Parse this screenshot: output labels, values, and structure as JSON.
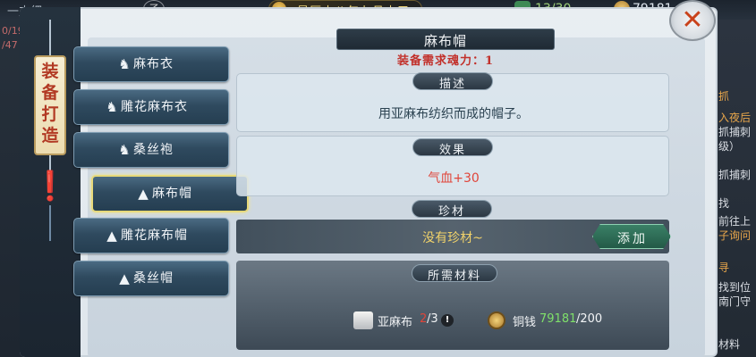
{
  "top_bar": {
    "left_text": "一支细",
    "zi_icon": "子",
    "date": "炅历十八年九月十五",
    "counter": "13/30",
    "coins": "79181"
  },
  "left_strip": {
    "num1": "0/19",
    "num2": "/47"
  },
  "side_tab": {
    "title": "装备打造"
  },
  "items": [
    {
      "icon": "clothes-icon",
      "label": "麻布衣",
      "selected": false
    },
    {
      "icon": "clothes-icon",
      "label": "雕花麻布衣",
      "selected": false
    },
    {
      "icon": "robe-icon",
      "label": "桑丝袍",
      "selected": false
    },
    {
      "icon": "hat-icon",
      "label": "麻布帽",
      "selected": true
    },
    {
      "icon": "hat-icon",
      "label": "雕花麻布帽",
      "selected": false
    },
    {
      "icon": "hat-icon",
      "label": "桑丝帽",
      "selected": false
    }
  ],
  "detail": {
    "title": "麻布帽",
    "requirement": "装备需求魂力：1",
    "description_header": "描述",
    "description": "用亚麻布纺织而成的帽子。",
    "effect_header": "效果",
    "effect": "气血+30",
    "gem_header": "珍材",
    "gem_status": "没有珍材~",
    "add_button": "添加",
    "materials_header": "所需材料",
    "materials": [
      {
        "icon": "linen-cloth-icon",
        "name": "亚麻布",
        "have": "2",
        "need": "/3"
      },
      {
        "icon": "copper-coin-icon",
        "name": "铜钱",
        "have": "79181",
        "need": "/200"
      }
    ]
  },
  "right_panel": {
    "lines": [
      "抓",
      "入夜后",
      "抓捕刺",
      "级）",
      "抓捕刺",
      "找",
      "前往上",
      "子询问",
      "寻",
      "找到位",
      "南门守",
      "材料"
    ]
  },
  "colors": {
    "requirement": "#c2302a",
    "effect": "#e0453a",
    "gem": "#f1d26a",
    "enough": "#7fe06a",
    "lacking": "#e0453a"
  }
}
